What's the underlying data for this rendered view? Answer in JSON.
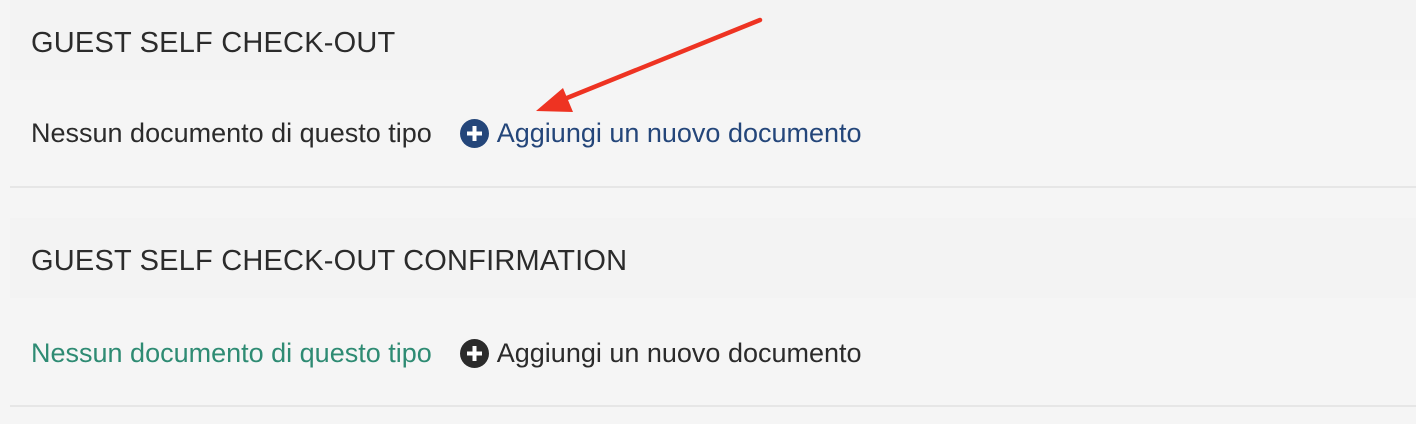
{
  "sections": [
    {
      "title": "GUEST SELF CHECK-OUT",
      "empty_text": "Nessun documento di questo tipo",
      "add_label": "Aggiungi un nuovo documento"
    },
    {
      "title": "GUEST SELF CHECK-OUT CONFIRMATION",
      "empty_text": "Nessun documento di questo tipo",
      "add_label": "Aggiungi un nuovo documento"
    }
  ],
  "colors": {
    "background": "#f5f5f5",
    "link_primary": "#24467a",
    "muted_text": "#2e8b73",
    "annotation_arrow": "#ee3322"
  },
  "icons": {
    "add": "plus-circle-icon",
    "annotation": "red-arrow-annotation"
  }
}
